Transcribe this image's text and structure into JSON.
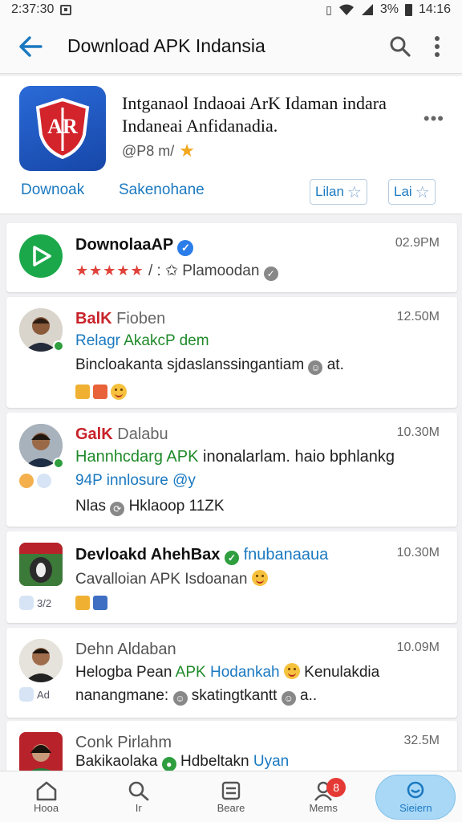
{
  "status_bar": {
    "time": "2:37:30",
    "battery": "3%",
    "clock": "14:16"
  },
  "app_bar": {
    "title": "Download APK Indansia"
  },
  "featured": {
    "title": "Intganaol Indaoai ArK Idaman indara Indaneai Anfidanadia.",
    "meta": "@P8  m/",
    "link_download": "Downoak",
    "link_secondary": "Sakenohane",
    "chip_left": "Lilan",
    "chip_right": "Lai",
    "icon_text": "AR"
  },
  "posts": [
    {
      "name": "DownolaaAP",
      "sub": "",
      "time": "02.9PM",
      "line1_left": "",
      "line1_right": "Plamoodan"
    },
    {
      "name": "BalK",
      "sub": "Fioben",
      "time": "12.50M",
      "line1_a": "Relagr",
      "line1_b": "AkakcP",
      "line1_c": "dem",
      "line2": "Bincloakanta sjdaslanssingantiam",
      "line2_tail": "at."
    },
    {
      "name": "GalK",
      "sub": "Dalabu",
      "time": "10.30M",
      "line1_a": "Hannhcdarg APK",
      "line1_b": "inonalarlam. haio bphlankg",
      "line2": "94P innlosure @y",
      "line3_a": "Nlas",
      "line3_b": "Hklaoop",
      "line3_c": "11ZK"
    },
    {
      "name": "Devloakd AhehBax",
      "tail": "fnubanaaua",
      "time": "10.30M",
      "line1": "Cavalloian APK Isdoanan",
      "mini": "3/2"
    },
    {
      "name": "Dehn Aldaban",
      "time": "10.09M",
      "line1_a": "Helogba Pean",
      "line1_b": "APK",
      "line1_c": "Hodankah",
      "line1_d": "Kenulakdia",
      "line2": "nanangmane:",
      "line2_b": "skatingtkantt",
      "line2_c": "a..",
      "mini": "Ad"
    },
    {
      "name": "Conk Pirlahm",
      "time": "32.5M",
      "line1_a": "Bakikaolaka",
      "line1_b": "Hdbeltakn",
      "line1_c": "Uyan"
    }
  ],
  "bottom_nav": [
    {
      "label": "Hooa",
      "icon": "home-icon"
    },
    {
      "label": "Ir",
      "icon": "search-icon"
    },
    {
      "label": "Beare",
      "icon": "sliders-icon"
    },
    {
      "label": "Mems",
      "icon": "person-icon",
      "badge": "8"
    },
    {
      "label": "Sieiern",
      "icon": "chat-icon"
    }
  ],
  "colors": {
    "accent": "#1b79c0",
    "brand_red": "#c8222a",
    "green": "#1f8a2a",
    "active_nav": "#a9d8f7"
  }
}
